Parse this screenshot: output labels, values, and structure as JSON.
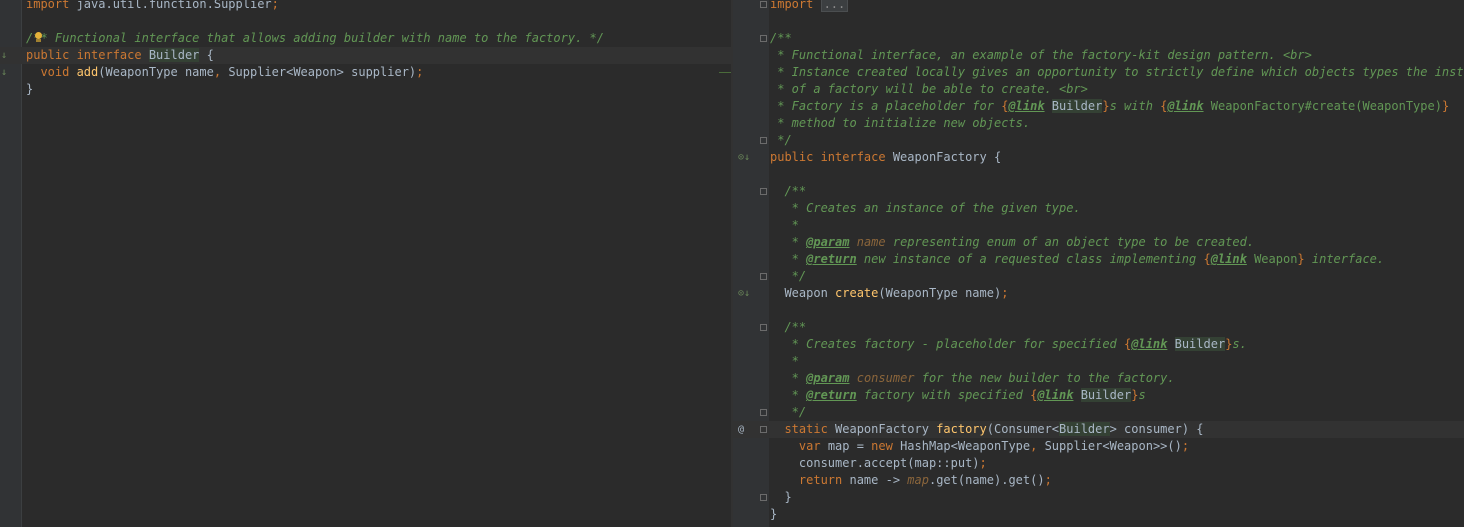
{
  "editor_left": {
    "lines": [
      {
        "tokens": [
          {
            "t": "import",
            "c": "k"
          },
          {
            "t": " java.util.function.Supplier"
          },
          {
            "t": ";",
            "c": "k"
          }
        ]
      },
      {
        "tokens": []
      },
      {
        "tokens": [
          {
            "t": "/** Functional interface that allows adding builder with name to the factory. */",
            "c": "cm"
          }
        ],
        "bulb": true
      },
      {
        "tokens": [
          {
            "t": "public ",
            "c": "k"
          },
          {
            "t": "interface ",
            "c": "k"
          },
          {
            "t": "Builder",
            "c": "hl"
          },
          {
            "t": " {"
          }
        ],
        "current": true,
        "gutter": "↓"
      },
      {
        "tokens": [
          {
            "t": "  "
          },
          {
            "t": "void ",
            "c": "k"
          },
          {
            "t": "add",
            "c": "fn"
          },
          {
            "t": "(WeaponType name"
          },
          {
            "t": ", ",
            "c": "k"
          },
          {
            "t": "Supplier<Weapon> supplier)"
          },
          {
            "t": ";",
            "c": "k"
          }
        ],
        "gutter": "↓",
        "marker": true
      },
      {
        "tokens": [
          {
            "t": "}"
          }
        ]
      }
    ]
  },
  "editor_right": {
    "lines": [
      {
        "tokens": [
          {
            "t": "import ",
            "c": "k"
          },
          {
            "t": "...",
            "c": "collapsed"
          }
        ],
        "fold": true
      },
      {
        "tokens": []
      },
      {
        "tokens": [
          {
            "t": "/**",
            "c": "cm"
          }
        ],
        "fold": true
      },
      {
        "tokens": [
          {
            "t": " * Functional interface, an example of the factory-kit design pattern. <br>",
            "c": "cm"
          }
        ]
      },
      {
        "tokens": [
          {
            "t": " * Instance created locally gives an opportunity to strictly define which objects types the instanc",
            "c": "cm"
          }
        ]
      },
      {
        "tokens": [
          {
            "t": " * of a factory will be able to create. <br>",
            "c": "cm"
          }
        ]
      },
      {
        "tokens": [
          {
            "t": " * Factory is a placeholder for ",
            "c": "cm"
          },
          {
            "t": "{",
            "c": "k"
          },
          {
            "t": "@link",
            "c": "tag"
          },
          {
            "t": " "
          },
          {
            "t": "Builder",
            "c": "hl"
          },
          {
            "t": "}",
            "c": "k"
          },
          {
            "t": "s with ",
            "c": "cm"
          },
          {
            "t": "{",
            "c": "k"
          },
          {
            "t": "@link",
            "c": "tag"
          },
          {
            "t": " WeaponFactory#create(WeaponType)",
            "c": "linkref"
          },
          {
            "t": "}",
            "c": "k"
          }
        ]
      },
      {
        "tokens": [
          {
            "t": " * method to initialize new objects.",
            "c": "cm"
          }
        ]
      },
      {
        "tokens": [
          {
            "t": " */",
            "c": "cm"
          }
        ],
        "fold": true
      },
      {
        "tokens": [
          {
            "t": "public ",
            "c": "k"
          },
          {
            "t": "interface ",
            "c": "k"
          },
          {
            "t": "WeaponFactory {"
          }
        ],
        "gutter": "⊙↓"
      },
      {
        "tokens": []
      },
      {
        "tokens": [
          {
            "t": "  "
          },
          {
            "t": "/**",
            "c": "cm"
          }
        ],
        "fold": true
      },
      {
        "tokens": [
          {
            "t": "   * Creates an instance of the given type.",
            "c": "cm"
          }
        ]
      },
      {
        "tokens": [
          {
            "t": "   *",
            "c": "cm"
          }
        ]
      },
      {
        "tokens": [
          {
            "t": "   * ",
            "c": "cm"
          },
          {
            "t": "@param",
            "c": "tag"
          },
          {
            "t": " "
          },
          {
            "t": "name",
            "c": "pname"
          },
          {
            "t": " representing enum of an object type to be created.",
            "c": "cm"
          }
        ]
      },
      {
        "tokens": [
          {
            "t": "   * ",
            "c": "cm"
          },
          {
            "t": "@return",
            "c": "tag"
          },
          {
            "t": " new instance of a requested class implementing ",
            "c": "cm"
          },
          {
            "t": "{",
            "c": "k"
          },
          {
            "t": "@link",
            "c": "tag"
          },
          {
            "t": " Weapon",
            "c": "linkref"
          },
          {
            "t": "}",
            "c": "k"
          },
          {
            "t": " interface.",
            "c": "cm"
          }
        ]
      },
      {
        "tokens": [
          {
            "t": "   */",
            "c": "cm"
          }
        ],
        "fold": true
      },
      {
        "tokens": [
          {
            "t": "  Weapon "
          },
          {
            "t": "create",
            "c": "fn"
          },
          {
            "t": "(WeaponType name)"
          },
          {
            "t": ";",
            "c": "k"
          }
        ],
        "gutter": "⊙↓"
      },
      {
        "tokens": []
      },
      {
        "tokens": [
          {
            "t": "  "
          },
          {
            "t": "/**",
            "c": "cm"
          }
        ],
        "fold": true
      },
      {
        "tokens": [
          {
            "t": "   * Creates factory - placeholder for specified ",
            "c": "cm"
          },
          {
            "t": "{",
            "c": "k"
          },
          {
            "t": "@link",
            "c": "tag"
          },
          {
            "t": " "
          },
          {
            "t": "Builder",
            "c": "hl"
          },
          {
            "t": "}",
            "c": "k"
          },
          {
            "t": "s.",
            "c": "cm"
          }
        ]
      },
      {
        "tokens": [
          {
            "t": "   *",
            "c": "cm"
          }
        ]
      },
      {
        "tokens": [
          {
            "t": "   * ",
            "c": "cm"
          },
          {
            "t": "@param",
            "c": "tag"
          },
          {
            "t": " "
          },
          {
            "t": "consumer",
            "c": "pname"
          },
          {
            "t": " for the new builder to the factory.",
            "c": "cm"
          }
        ]
      },
      {
        "tokens": [
          {
            "t": "   * ",
            "c": "cm"
          },
          {
            "t": "@return",
            "c": "tag"
          },
          {
            "t": " factory with specified ",
            "c": "cm"
          },
          {
            "t": "{",
            "c": "k"
          },
          {
            "t": "@link",
            "c": "tag"
          },
          {
            "t": " "
          },
          {
            "t": "Builder",
            "c": "hl"
          },
          {
            "t": "}",
            "c": "k"
          },
          {
            "t": "s",
            "c": "cm"
          }
        ]
      },
      {
        "tokens": [
          {
            "t": "   */",
            "c": "cm"
          }
        ],
        "fold": true
      },
      {
        "tokens": [
          {
            "t": "  "
          },
          {
            "t": "static ",
            "c": "k"
          },
          {
            "t": "WeaponFactory "
          },
          {
            "t": "factory",
            "c": "fn"
          },
          {
            "t": "(Consumer<"
          },
          {
            "t": "Builder",
            "c": "hl"
          },
          {
            "t": "> consumer) {"
          }
        ],
        "current": true,
        "gutter": "@",
        "fold": true
      },
      {
        "tokens": [
          {
            "t": "    "
          },
          {
            "t": "var ",
            "c": "k"
          },
          {
            "t": "map = "
          },
          {
            "t": "new ",
            "c": "k"
          },
          {
            "t": "HashMap<WeaponType"
          },
          {
            "t": ", ",
            "c": "k"
          },
          {
            "t": "Supplier<Weapon>>()"
          },
          {
            "t": ";",
            "c": "k"
          }
        ]
      },
      {
        "tokens": [
          {
            "t": "    consumer.accept(map::put)"
          },
          {
            "t": ";",
            "c": "k"
          }
        ]
      },
      {
        "tokens": [
          {
            "t": "    "
          },
          {
            "t": "return ",
            "c": "k"
          },
          {
            "t": "name -> "
          },
          {
            "t": "map",
            "c": "pname"
          },
          {
            "t": ".get(name).get()"
          },
          {
            "t": ";",
            "c": "k"
          }
        ]
      },
      {
        "tokens": [
          {
            "t": "  }"
          }
        ],
        "fold": true
      },
      {
        "tokens": [
          {
            "t": "}"
          }
        ]
      }
    ]
  },
  "colors": {
    "background": "#2b2b2b",
    "keyword": "#cc7832",
    "comment": "#629755",
    "method": "#ffc66d",
    "text": "#a9b7c6"
  }
}
